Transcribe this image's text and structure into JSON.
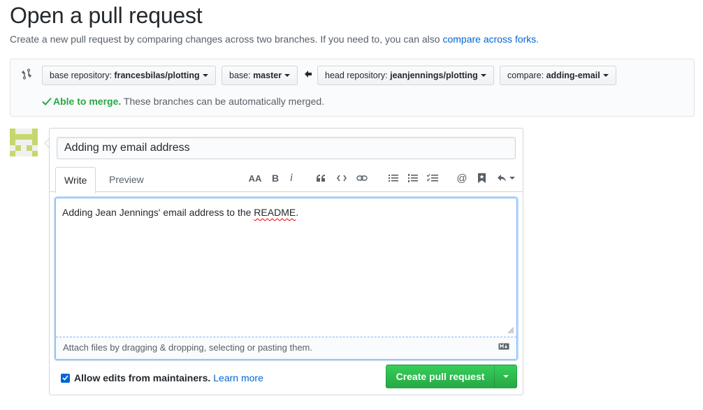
{
  "page": {
    "title": "Open a pull request",
    "subtitle_text": "Create a new pull request by comparing changes across two branches. If you need to, you can also ",
    "subtitle_link": "compare across forks",
    "subtitle_end": "."
  },
  "compare": {
    "base_repo_label": "base repository: ",
    "base_repo_value": "francesbilas/plotting",
    "base_label": "base: ",
    "base_value": "master",
    "head_repo_label": "head repository: ",
    "head_repo_value": "jeanjennings/plotting",
    "compare_label": "compare: ",
    "compare_value": "adding-email",
    "merge_ok": "Able to merge.",
    "merge_text": " These branches can be automatically merged."
  },
  "form": {
    "title_value": "Adding my email address",
    "tabs": [
      "Write",
      "Preview"
    ],
    "toolbar": {
      "heading": "AA",
      "bold": "B",
      "italic": "i",
      "mention": "@"
    },
    "body_before": "Adding Jean Jennings' email address to the ",
    "body_misspelled": "README",
    "body_after": ".",
    "attach_hint": "Attach files by dragging & dropping, selecting or pasting them.",
    "allow_edits_label": "Allow edits from maintainers.",
    "learn_more": "Learn more",
    "allow_edits_checked": true,
    "submit_label": "Create pull request"
  },
  "colors": {
    "accent": "#0366d6",
    "success": "#28a745",
    "border": "#d1d5da"
  }
}
